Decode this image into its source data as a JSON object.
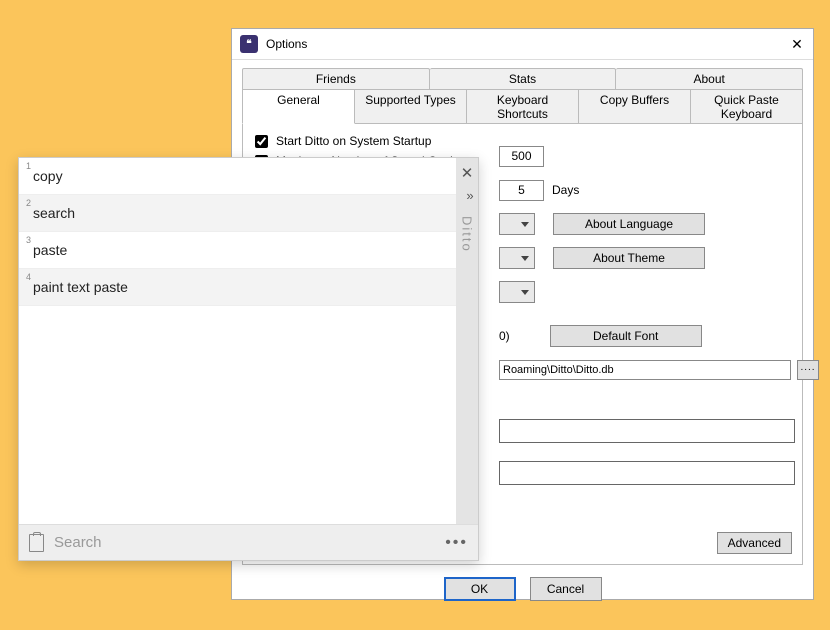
{
  "options": {
    "title": "Options",
    "tabs_row1": [
      "Friends",
      "Stats",
      "About"
    ],
    "tabs_row2": [
      "General",
      "Supported Types",
      "Keyboard Shortcuts",
      "Copy Buffers",
      "Quick Paste Keyboard"
    ],
    "active_tab": "General",
    "start_on_startup_label": "Start Ditto on System Startup",
    "start_on_startup_checked": true,
    "max_copies_label": "Maximum Number of Saved Copies",
    "max_copies_checked": true,
    "max_copies_value": "500",
    "days_value": "5",
    "days_label": "Days",
    "about_language_label": "About Language",
    "about_theme_label": "About Theme",
    "zero_text": "0)",
    "default_font_label": "Default Font",
    "db_path": "Roaming\\Ditto\\Ditto.db",
    "advanced_label": "Advanced",
    "ok_label": "OK",
    "cancel_label": "Cancel"
  },
  "ditto": {
    "title": "Ditto",
    "items": [
      {
        "n": "1",
        "text": "copy"
      },
      {
        "n": "2",
        "text": "search"
      },
      {
        "n": "3",
        "text": "paste"
      },
      {
        "n": "4",
        "text": "paint text paste"
      }
    ],
    "search_placeholder": "Search"
  }
}
